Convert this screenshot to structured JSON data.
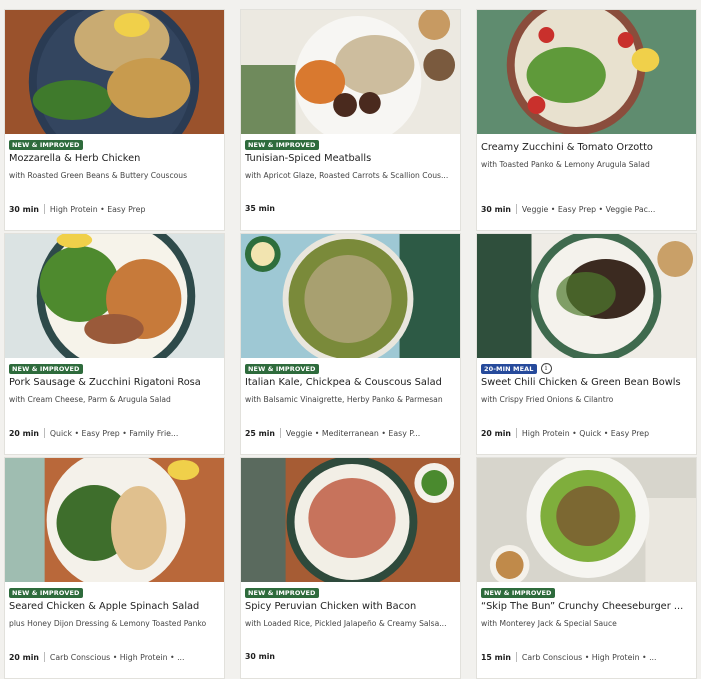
{
  "colors": {
    "page_bg": "#f2f1ee",
    "badge_new": "#2e6b3c",
    "badge_20min": "#264a9b"
  },
  "recipes": [
    {
      "badge": "NEW & IMPROVED",
      "title": "Mozzarella & Herb Chicken",
      "subtitle": "with Roasted Green Beans & Buttery Couscous",
      "time": "30 min",
      "tags": "High Protein • Easy Prep"
    },
    {
      "badge": "NEW & IMPROVED",
      "title": "Tunisian-Spiced Meatballs",
      "subtitle": "with Apricot Glaze, Roasted Carrots & Scallion Cous...",
      "time": "35 min",
      "tags": ""
    },
    {
      "badge": "",
      "title": "Creamy Zucchini & Tomato Orzotto",
      "subtitle": "with Toasted Panko & Lemony Arugula Salad",
      "time": "30 min",
      "tags": "Veggie • Easy Prep • Veggie Pac..."
    },
    {
      "badge": "NEW & IMPROVED",
      "title": "Pork Sausage & Zucchini Rigatoni Rosa",
      "subtitle": "with Cream Cheese, Parm & Arugula Salad",
      "time": "20 min",
      "tags": "Quick • Easy Prep • Family Frie..."
    },
    {
      "badge": "NEW & IMPROVED",
      "title": "Italian Kale, Chickpea & Couscous Salad",
      "subtitle": "with Balsamic Vinaigrette, Herby Panko & Parmesan",
      "time": "25 min",
      "tags": "Veggie • Mediterranean • Easy P..."
    },
    {
      "badge": "20-MIN MEAL",
      "title": "Sweet Chili Chicken & Green Bean Bowls",
      "subtitle": "with Crispy Fried Onions & Cilantro",
      "time": "20 min",
      "tags": "High Protein • Quick • Easy Prep"
    },
    {
      "badge": "NEW & IMPROVED",
      "title": "Seared Chicken & Apple Spinach Salad",
      "subtitle": "plus Honey Dijon Dressing & Lemony Toasted Panko",
      "time": "20 min",
      "tags": "Carb Conscious • High Protein • ..."
    },
    {
      "badge": "NEW & IMPROVED",
      "title": "Spicy Peruvian Chicken with Bacon",
      "subtitle": "with Loaded Rice, Pickled Jalapeño & Creamy Salsa...",
      "time": "30 min",
      "tags": ""
    },
    {
      "badge": "NEW & IMPROVED",
      "title": "“Skip The Bun” Crunchy Cheeseburger ...",
      "subtitle": "with Monterey Jack & Special Sauce",
      "time": "15 min",
      "tags": "Carb Conscious • High Protein • ..."
    }
  ]
}
